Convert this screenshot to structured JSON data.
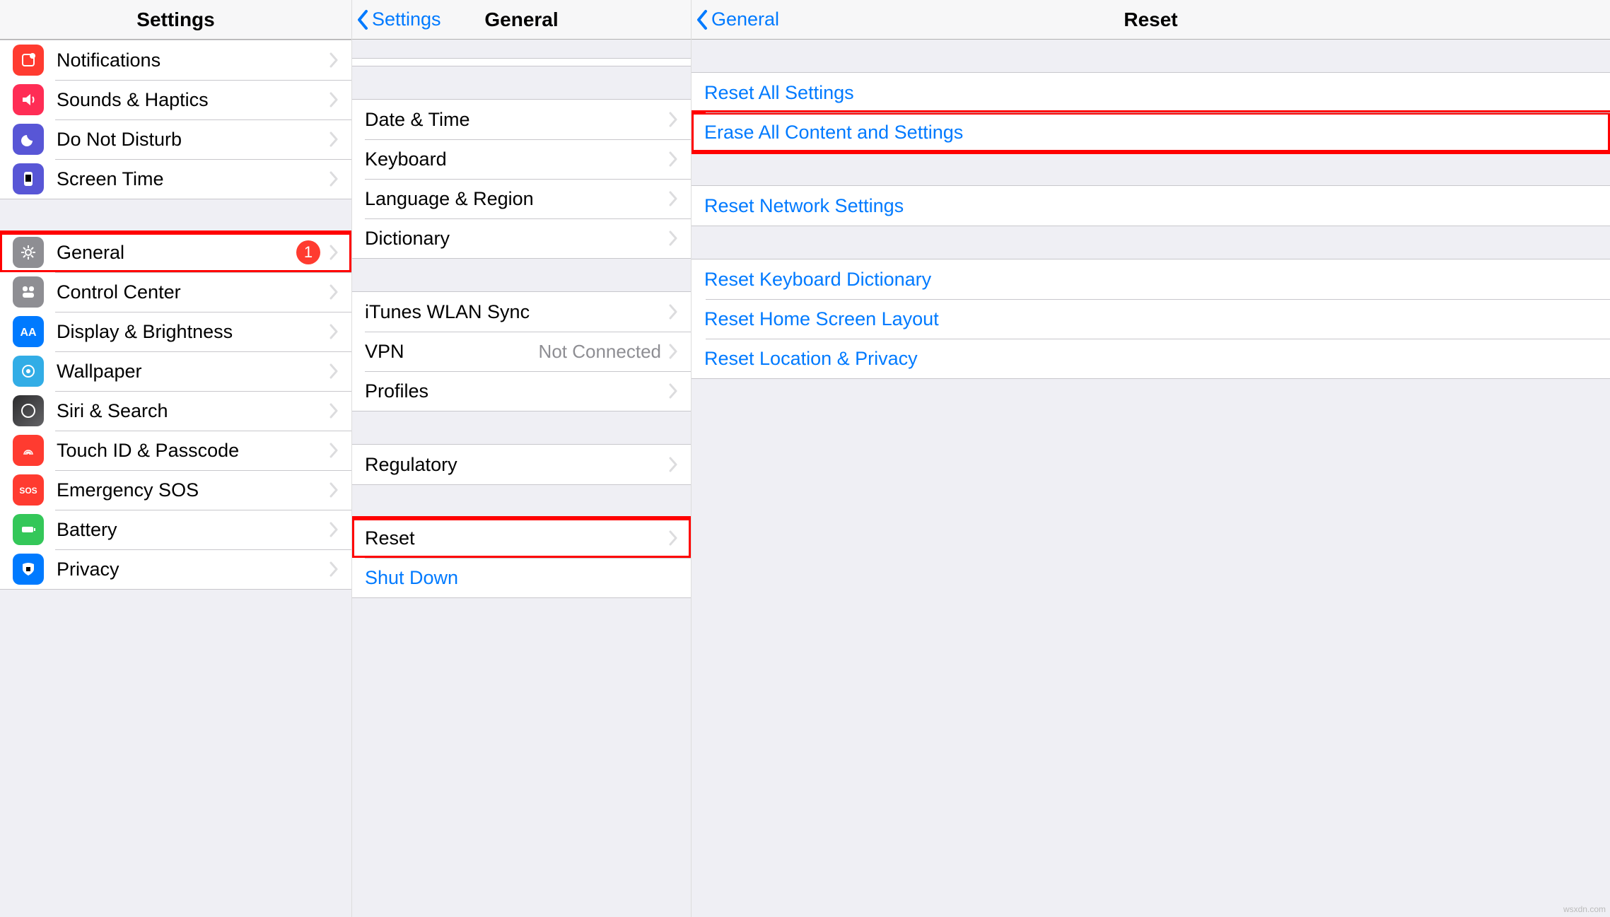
{
  "panel1": {
    "title": "Settings",
    "groups": [
      [
        {
          "icon": "notifications-icon",
          "label": "Notifications"
        },
        {
          "icon": "sounds-icon",
          "label": "Sounds & Haptics"
        },
        {
          "icon": "dnd-icon",
          "label": "Do Not Disturb"
        },
        {
          "icon": "screentime-icon",
          "label": "Screen Time"
        }
      ],
      [
        {
          "icon": "general-icon",
          "label": "General",
          "badge": "1",
          "highlight": true
        },
        {
          "icon": "controlcenter-icon",
          "label": "Control Center"
        },
        {
          "icon": "display-icon",
          "label": "Display & Brightness"
        },
        {
          "icon": "wallpaper-icon",
          "label": "Wallpaper"
        },
        {
          "icon": "siri-icon",
          "label": "Siri & Search"
        },
        {
          "icon": "touchid-icon",
          "label": "Touch ID & Passcode"
        },
        {
          "icon": "sos-icon",
          "label": "Emergency SOS"
        },
        {
          "icon": "battery-icon",
          "label": "Battery"
        },
        {
          "icon": "privacy-icon",
          "label": "Privacy"
        }
      ]
    ]
  },
  "panel2": {
    "back": "Settings",
    "title": "General",
    "groups": [
      [
        {
          "label": "Date & Time"
        },
        {
          "label": "Keyboard"
        },
        {
          "label": "Language & Region"
        },
        {
          "label": "Dictionary"
        }
      ],
      [
        {
          "label": "iTunes WLAN Sync"
        },
        {
          "label": "VPN",
          "detail": "Not Connected"
        },
        {
          "label": "Profiles"
        }
      ],
      [
        {
          "label": "Regulatory"
        }
      ],
      [
        {
          "label": "Reset",
          "highlight": true
        },
        {
          "label": "Shut Down",
          "link": true,
          "nochev": true
        }
      ]
    ]
  },
  "panel3": {
    "back": "General",
    "title": "Reset",
    "groups": [
      [
        {
          "label": "Reset All Settings"
        },
        {
          "label": "Erase All Content and Settings",
          "highlight": true
        }
      ],
      [
        {
          "label": "Reset Network Settings"
        }
      ],
      [
        {
          "label": "Reset Keyboard Dictionary"
        },
        {
          "label": "Reset Home Screen Layout"
        },
        {
          "label": "Reset Location & Privacy"
        }
      ]
    ]
  },
  "iconColors": {
    "notifications-icon": "ic-red",
    "sounds-icon": "ic-pink",
    "dnd-icon": "ic-purple",
    "screentime-icon": "ic-indigo",
    "general-icon": "ic-gray",
    "controlcenter-icon": "ic-gray",
    "display-icon": "ic-blue",
    "wallpaper-icon": "ic-cyan",
    "siri-icon": "ic-black",
    "touchid-icon": "ic-red",
    "sos-icon": "ic-orange",
    "battery-icon": "ic-green",
    "privacy-icon": "ic-blue"
  },
  "iconGlyphs": {
    "notifications-icon": "<rect x='6' y='6' width='16' height='16' rx='3' fill='none' stroke='white' stroke-width='2'/><circle cx='20' cy='8' r='4' fill='white'/>",
    "sounds-icon": "<path d='M6 11v6h5l6 5V6l-6 5H6z' fill='white'/><path d='M20 10c2 2 2 6 0 8' stroke='white' stroke-width='2' fill='none'/>",
    "dnd-icon": "<path d='M20 16a8 8 0 1 1-8-8c0 4 4 8 8 8z' fill='white'/>",
    "screentime-icon": "<rect x='8' y='4' width='12' height='20' rx='3' fill='white'/><rect x='10' y='8' width='8' height='10' fill='%235856d6'/>",
    "general-icon": "<circle cx='14' cy='14' r='4' fill='none' stroke='white' stroke-width='2'/><path d='M14 4v4M14 20v4M4 14h4M20 14h4M7 7l3 3M18 18l3 3M21 7l-3 3M10 18l-3 3' stroke='white' stroke-width='2'/>",
    "controlcenter-icon": "<rect x='6' y='6' width='7' height='7' rx='3' fill='white'/><rect x='15' y='6' width='7' height='7' rx='3' fill='white'/><rect x='6' y='15' width='16' height='7' rx='3' fill='white'/>",
    "display-icon": "<text x='14' y='20' text-anchor='middle' font-size='16' font-weight='bold' fill='white'>AA</text>",
    "wallpaper-icon": "<circle cx='14' cy='14' r='8' fill='none' stroke='white' stroke-width='2'/><circle cx='14' cy='14' r='3' fill='white'/>",
    "siri-icon": "<circle cx='14' cy='14' r='9' fill='none' stroke='white' stroke-width='2'/><path d='M8 14c3-6 9 6 12 0' stroke='%23ff2d55' stroke-width='2' fill='none'/>",
    "touchid-icon": "<path d='M8 20c0-8 12-8 12 0M10 20c0-5 8-5 8 0M12 20c0-3 4-3 4 0' stroke='white' stroke-width='1.5' fill='none'/>",
    "sos-icon": "<text x='14' y='19' text-anchor='middle' font-size='12' font-weight='bold' fill='white'>SOS</text>",
    "battery-icon": "<rect x='5' y='10' width='16' height='8' rx='2' fill='white'/><rect x='22' y='12' width='2' height='4' fill='white'/>",
    "privacy-icon": "<path d='M14 5c4 0 8 2 8 2v7c0 5-8 9-8 9s-8-4-8-9V7s4-2 8-2z' fill='white'/><rect x='11' y='11' width='6' height='6' fill='%23007aff'/>"
  },
  "watermark": "wsxdn.com"
}
